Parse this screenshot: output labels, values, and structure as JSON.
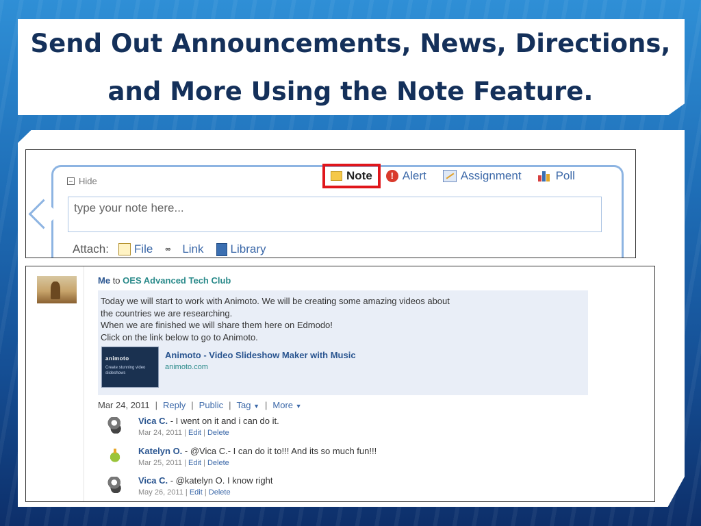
{
  "slide": {
    "title_line1": "Send Out Announcements, News, Directions,",
    "title_line2": "and More Using the Note Feature."
  },
  "composer": {
    "hide_label": "Hide",
    "post_types": [
      {
        "label": "Note",
        "icon": "note-icon",
        "selected": true
      },
      {
        "label": "Alert",
        "icon": "alert-icon"
      },
      {
        "label": "Assignment",
        "icon": "assignment-icon"
      },
      {
        "label": "Poll",
        "icon": "poll-icon"
      }
    ],
    "input_placeholder": "type your note here...",
    "attach_label": "Attach:",
    "attach_items": [
      {
        "label": "File",
        "icon": "file-icon"
      },
      {
        "label": "Link",
        "icon": "link-icon"
      },
      {
        "label": "Library",
        "icon": "library-icon"
      }
    ],
    "highlight_color": "#e0161b"
  },
  "post": {
    "sender": "Me",
    "to_word": "to",
    "group": "OES Advanced Tech Club",
    "body_lines": [
      "Today we will start to work with Animoto. We will be creating some amazing videos about",
      "the countries we are researching.",
      "When we are finished we will share them here on Edmodo!",
      "Click on the link below to go to Animoto."
    ],
    "link_card": {
      "thumb_logo": "animoto",
      "thumb_text": "Create stunning video slideshows",
      "title": "Animoto - Video Slideshow Maker with Music",
      "url": "animoto.com"
    },
    "actions": {
      "date": "Mar 24, 2011",
      "reply": "Reply",
      "public": "Public",
      "tag": "Tag",
      "more": "More",
      "separator": "|"
    },
    "comments": [
      {
        "author": "Vica C.",
        "text": " - I went on it and i can do it.",
        "date": "Mar 24, 2011",
        "edit": "Edit",
        "delete": "Delete",
        "avatar": "grey"
      },
      {
        "author": "Katelyn O.",
        "text": " - @Vica C.- I can do it to!!! And its so much fun!!!",
        "date": "Mar 25, 2011",
        "edit": "Edit",
        "delete": "Delete",
        "avatar": "green"
      },
      {
        "author": "Vica C.",
        "text": " - @katelyn O. I know right",
        "date": "May 26, 2011",
        "edit": "Edit",
        "delete": "Delete",
        "avatar": "grey"
      }
    ]
  }
}
